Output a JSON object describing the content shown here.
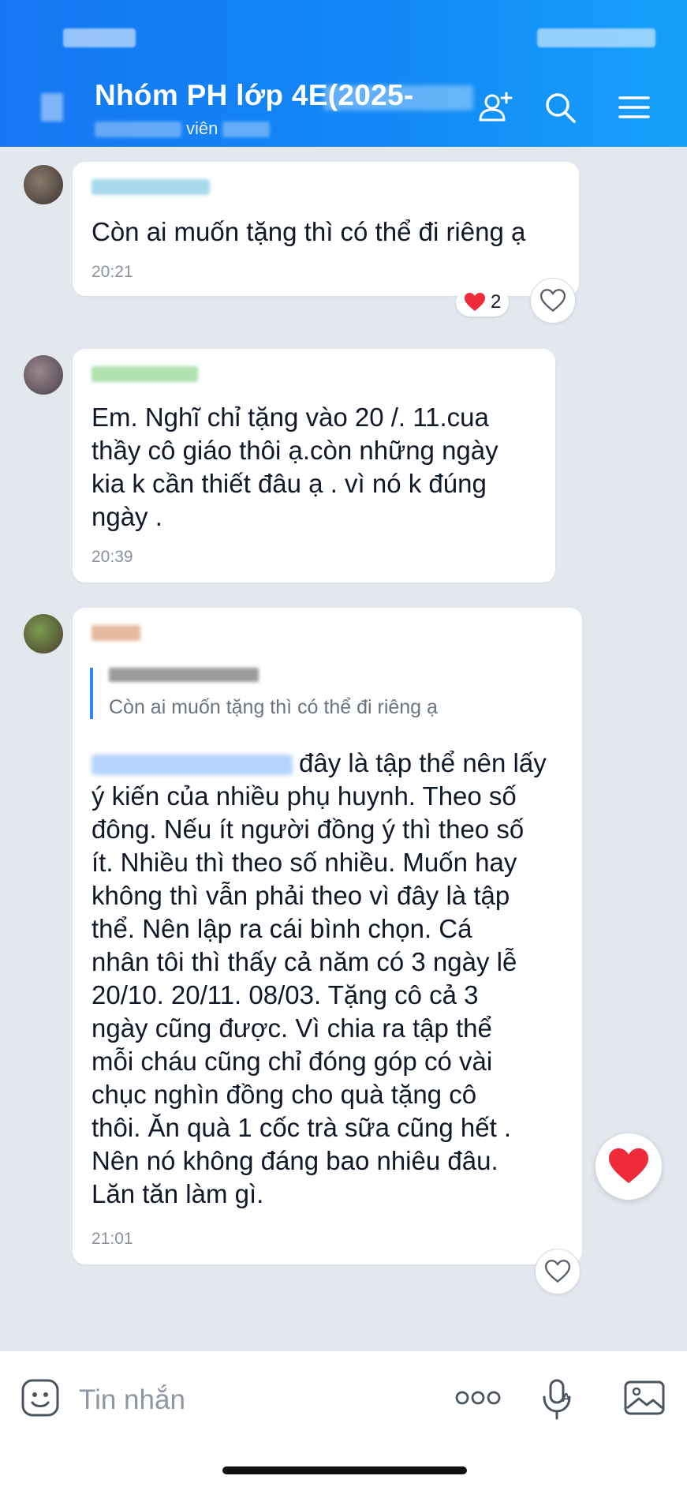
{
  "header": {
    "title": "Nhóm PH lớp 4E(2025-",
    "subtitle_suffix": "viên",
    "accent_gradient": [
      "#1677f2",
      "#17a0fb"
    ]
  },
  "messages": [
    {
      "text": "Còn ai muốn tặng thì có thể đi riêng ạ",
      "time": "20:21",
      "reaction": {
        "icon": "heart-icon",
        "count": "2"
      }
    },
    {
      "text_lines": [
        "Em. Nghĩ chỉ tặng vào 20 /. 11.cua",
        "thầy cô giáo thôi ạ.còn những ngày",
        "kia k cần thiết đâu ạ . vì  nó k đúng",
        "ngày ."
      ],
      "time": "20:39"
    },
    {
      "quote_text": "Còn ai muốn tặng thì có thể đi riêng ạ",
      "first_line_tail": "đây là tập thể nên lấy",
      "text_lines": [
        "ý kiến của nhiều phụ huynh. Theo số",
        "đông. Nếu ít người đồng ý thì theo số",
        "ít. Nhiều thì theo số nhiều. Muốn hay",
        "không thì vẫn phải theo vì đây là tập",
        "thể. Nên lập ra cái bình chọn. Cá",
        "nhân tôi thì thấy cả năm có 3 ngày lễ",
        "20/10. 20/11. 08/03. Tặng cô cả 3",
        "ngày cũng được. Vì chia ra tập thể",
        "mỗi cháu cũng chỉ đóng góp có vài",
        "chục nghìn đồng cho quà tặng cô",
        "thôi. Ăn quà 1 cốc trà sữa cũng hết .",
        "Nên nó không đáng bao nhiêu đâu.",
        "Lăn tăn làm gì."
      ],
      "time": "21:01"
    }
  ],
  "composer": {
    "placeholder": "Tin nhắn",
    "icons": [
      "sticker-icon",
      "more-icon",
      "voice-icon",
      "image-icon"
    ]
  },
  "colors": {
    "heart": "#ef2b3a",
    "bubble": "#ffffff",
    "background": "#e3e7ee"
  }
}
